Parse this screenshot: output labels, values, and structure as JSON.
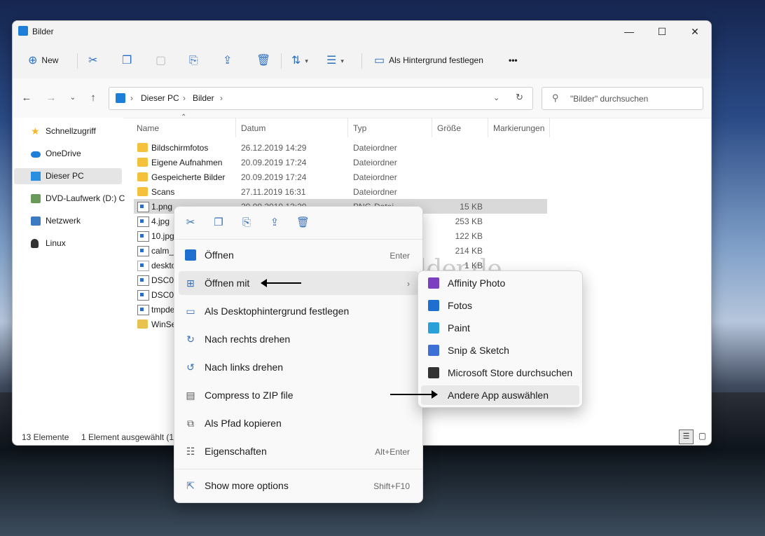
{
  "window": {
    "title": "Bilder"
  },
  "window_controls": {
    "minimize": "—",
    "maximize": "☐",
    "close": "✕"
  },
  "toolbar": {
    "new_label": "New",
    "set_background_label": "Als Hintergrund festlegen",
    "more_label": "•••"
  },
  "address": {
    "crumbs": [
      "Dieser PC",
      "Bilder"
    ],
    "separator": "›",
    "search_placeholder": "\"Bilder\" durchsuchen"
  },
  "sidebar": {
    "items": [
      {
        "label": "Schnellzugriff",
        "icon": "star-icon",
        "color": "#f2b72a"
      },
      {
        "label": "OneDrive",
        "icon": "cloud-icon",
        "color": "#1e7fd8"
      },
      {
        "label": "Dieser PC",
        "icon": "pc-icon",
        "color": "#2a8fe0"
      },
      {
        "label": "DVD-Laufwerk (D:) C",
        "icon": "dvd-icon",
        "color": "#6a9a5a"
      },
      {
        "label": "Netzwerk",
        "icon": "network-icon",
        "color": "#3c7ac2"
      },
      {
        "label": "Linux",
        "icon": "penguin-icon",
        "color": "#333333"
      }
    ]
  },
  "columns": {
    "name": "Name",
    "date": "Datum",
    "type": "Typ",
    "size": "Größe",
    "tags": "Markierungen"
  },
  "files": [
    {
      "name": "Bildschirmfotos",
      "date": "26.12.2019 14:29",
      "type": "Dateiordner",
      "size": "",
      "kind": "folder"
    },
    {
      "name": "Eigene Aufnahmen",
      "date": "20.09.2019 17:24",
      "type": "Dateiordner",
      "size": "",
      "kind": "folder"
    },
    {
      "name": "Gespeicherte Bilder",
      "date": "20.09.2019 17:24",
      "type": "Dateiordner",
      "size": "",
      "kind": "folder"
    },
    {
      "name": "Scans",
      "date": "27.11.2019 16:31",
      "type": "Dateiordner",
      "size": "",
      "kind": "folder"
    },
    {
      "name": "1.png",
      "date": "20.09.2019 13:20",
      "type": "PNG-Datei",
      "size": "15 KB",
      "kind": "file"
    },
    {
      "name": "4.jpg",
      "date": "",
      "type": "",
      "size": "253 KB",
      "kind": "file"
    },
    {
      "name": "10.jpg",
      "date": "",
      "type": "",
      "size": "122 KB",
      "kind": "file"
    },
    {
      "name": "calm_s",
      "date": "",
      "type": "",
      "size": "214 KB",
      "kind": "file"
    },
    {
      "name": "deskto",
      "date": "",
      "type": "",
      "size": "1 KB",
      "kind": "file"
    },
    {
      "name": "DSC00",
      "date": "",
      "type": "",
      "size": "",
      "kind": "file"
    },
    {
      "name": "DSC00",
      "date": "",
      "type": "",
      "size": "",
      "kind": "file"
    },
    {
      "name": "tmpde",
      "date": "",
      "type": "",
      "size": "",
      "kind": "file"
    },
    {
      "name": "WinSe",
      "date": "",
      "type": "",
      "size": "",
      "kind": "folder"
    }
  ],
  "status": {
    "count": "13 Elemente",
    "selected": "1 Element ausgewählt (14"
  },
  "context_menu": {
    "items": [
      {
        "label": "Öffnen",
        "shortcut": "Enter",
        "icon": "photo-icon"
      },
      {
        "label": "Öffnen mit",
        "shortcut": "›",
        "icon": "open-with-icon"
      },
      {
        "label": "Als Desktophintergrund festlegen",
        "shortcut": "",
        "icon": "desktop-bg-icon"
      },
      {
        "label": "Nach rechts drehen",
        "shortcut": "",
        "icon": "rotate-right-icon"
      },
      {
        "label": "Nach links drehen",
        "shortcut": "",
        "icon": "rotate-left-icon"
      },
      {
        "label": "Compress to ZIP file",
        "shortcut": "",
        "icon": "zip-icon"
      },
      {
        "label": "Als Pfad kopieren",
        "shortcut": "",
        "icon": "copy-path-icon"
      },
      {
        "label": "Eigenschaften",
        "shortcut": "Alt+Enter",
        "icon": "properties-icon"
      },
      {
        "label": "Show more options",
        "shortcut": "Shift+F10",
        "icon": "more-options-icon"
      }
    ]
  },
  "open_with_menu": {
    "items": [
      {
        "label": "Affinity Photo",
        "color": "#7b3fbf"
      },
      {
        "label": "Fotos",
        "color": "#1e6fcf"
      },
      {
        "label": "Paint",
        "color": "#2aa0d8"
      },
      {
        "label": "Snip & Sketch",
        "color": "#3d6fd6"
      },
      {
        "label": "Microsoft Store durchsuchen",
        "color": "#333333"
      },
      {
        "label": "Andere App auswählen",
        "color": ""
      }
    ]
  },
  "watermark": "Deskmodder.de"
}
